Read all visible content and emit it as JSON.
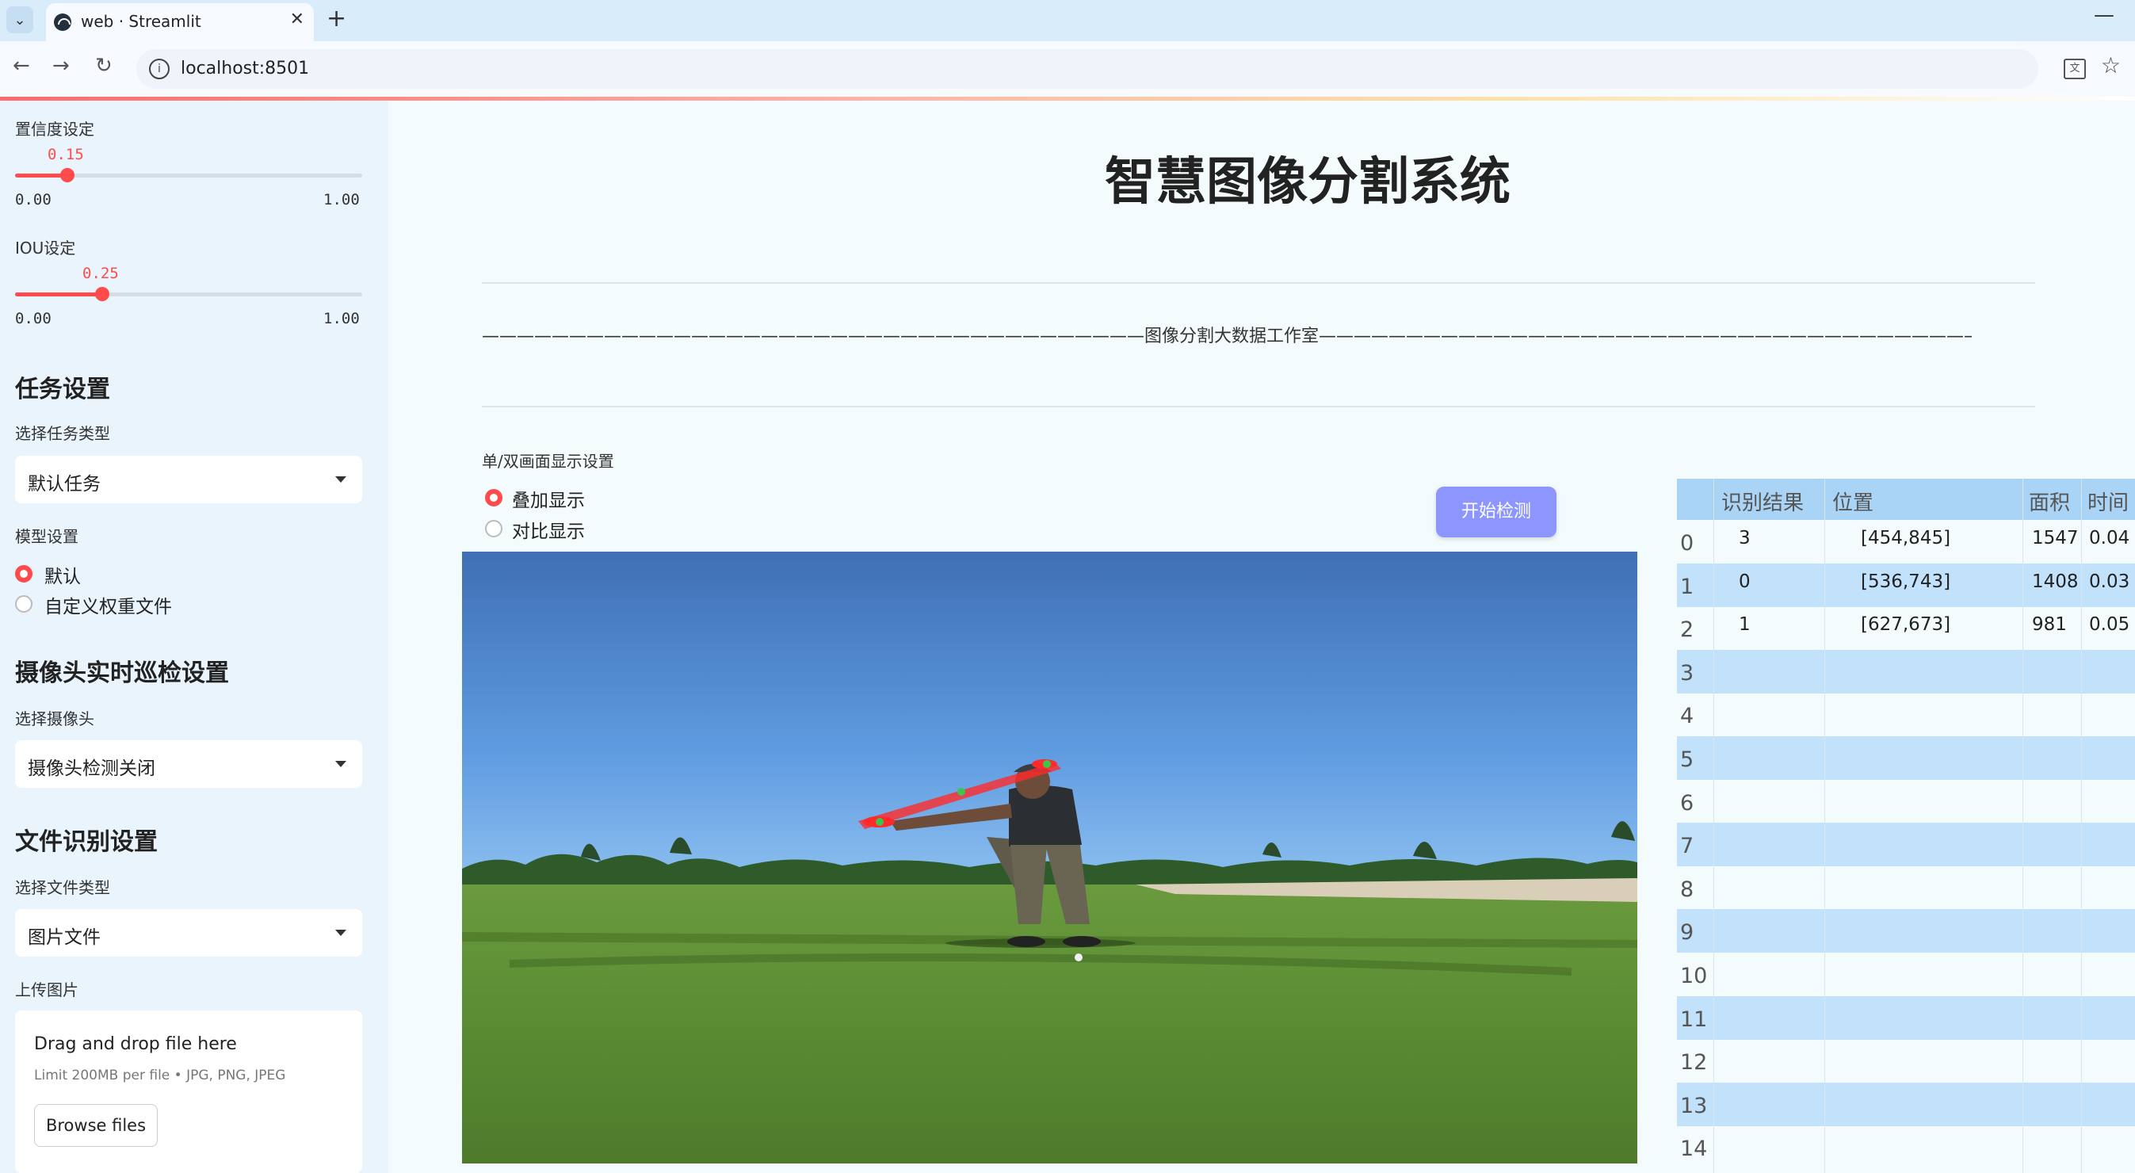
{
  "browser": {
    "tab_title": "web · Streamlit",
    "url": "localhost:8501"
  },
  "sidebar": {
    "confidence": {
      "label": "置信度设定",
      "value": "0.15",
      "value_num": 0.15,
      "min": "0.00",
      "max": "1.00"
    },
    "iou": {
      "label": "IOU设定",
      "value": "0.25",
      "value_num": 0.25,
      "min": "0.00",
      "max": "1.00"
    },
    "task": {
      "heading": "任务设置",
      "label": "选择任务类型",
      "selected": "默认任务"
    },
    "model": {
      "label": "模型设置",
      "options": [
        "默认",
        "自定义权重文件"
      ],
      "selected_index": 0
    },
    "camera": {
      "heading": "摄像头实时巡检设置",
      "label": "选择摄像头",
      "selected": "摄像头检测关闭"
    },
    "file": {
      "heading": "文件识别设置",
      "label": "选择文件类型",
      "selected": "图片文件"
    },
    "upload": {
      "label": "上传图片",
      "drop_text": "Drag and drop file here",
      "limit_text": "Limit 200MB per file • JPG, PNG, JPEG",
      "browse_label": "Browse files"
    }
  },
  "main": {
    "title": "智慧图像分割系统",
    "divider_text": "——————————————————————————————————————图像分割大数据工作室——————————————————————————————————————",
    "display_mode": {
      "label": "单/双画面显示设置",
      "options": [
        "叠加显示",
        "对比显示"
      ],
      "selected_index": 0
    },
    "start_button": "开始检测"
  },
  "results_table": {
    "headers": [
      "识别结果",
      "位置",
      "面积",
      "时间"
    ],
    "index": [
      "0",
      "1",
      "2",
      "3",
      "4",
      "5",
      "6",
      "7",
      "8",
      "9",
      "10",
      "11",
      "12",
      "13",
      "14"
    ],
    "rows": [
      [
        "3",
        "[454,845]",
        "1547",
        "0.04"
      ],
      [
        "0",
        "[536,743]",
        "1408",
        "0.03"
      ],
      [
        "1",
        "[627,673]",
        "981",
        "0.05"
      ]
    ]
  },
  "colors": {
    "accent": "#ff4b4b",
    "button": "#8d96ff",
    "table_header": "#a9d4f5",
    "table_alt_row": "#c2e1fa"
  }
}
